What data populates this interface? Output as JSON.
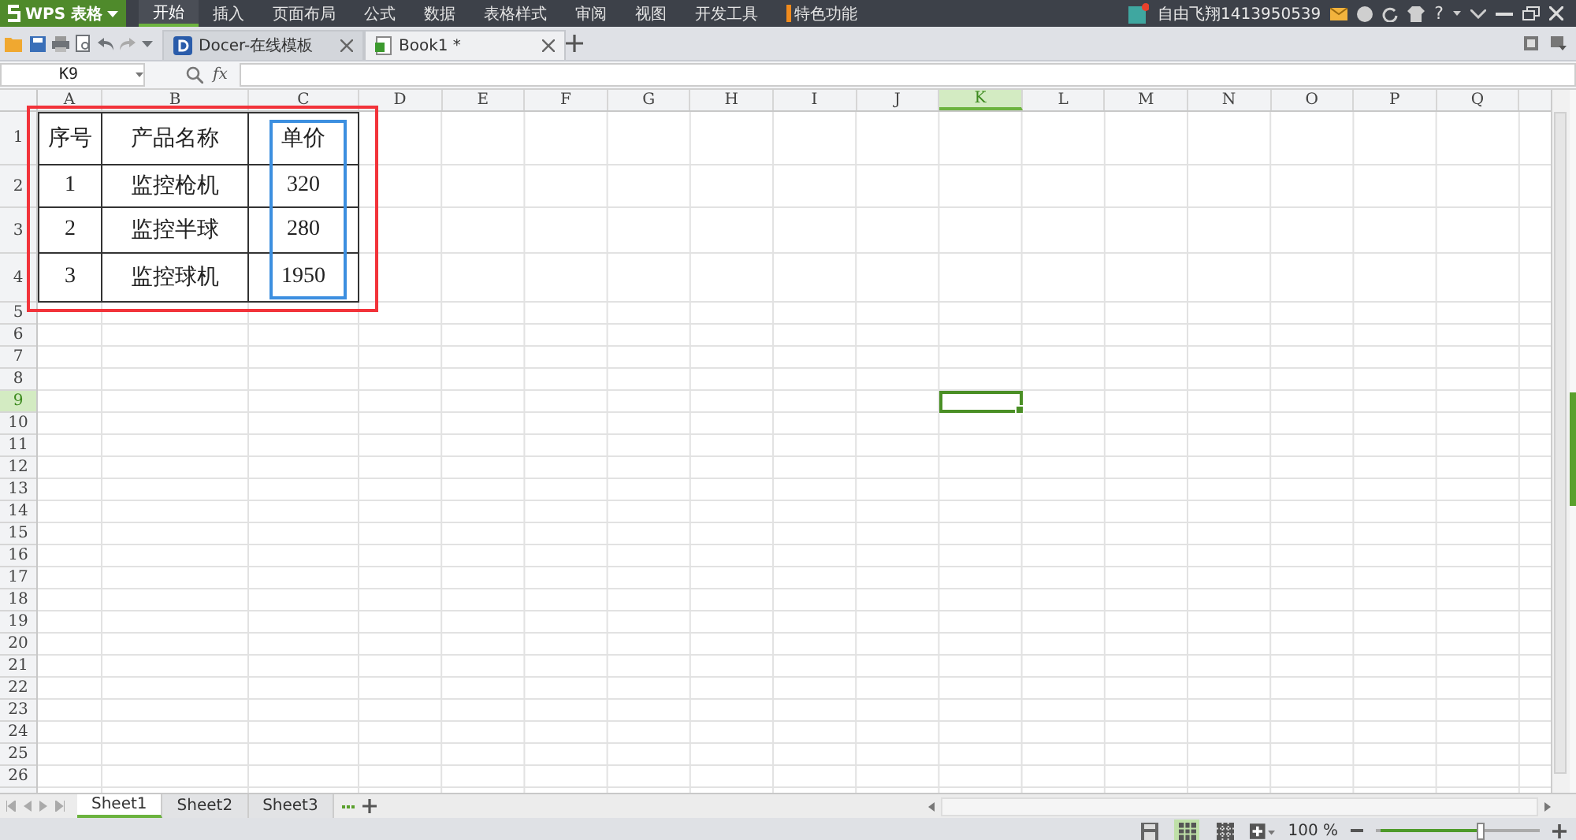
{
  "app_button": {
    "label": "WPS 表格"
  },
  "menu_tabs": [
    {
      "label": "开始",
      "selected": true
    },
    {
      "label": "插入",
      "selected": false
    },
    {
      "label": "页面布局",
      "selected": false
    },
    {
      "label": "公式",
      "selected": false
    },
    {
      "label": "数据",
      "selected": false
    },
    {
      "label": "表格样式",
      "selected": false
    },
    {
      "label": "审阅",
      "selected": false
    },
    {
      "label": "视图",
      "selected": false
    },
    {
      "label": "开发工具",
      "selected": false
    },
    {
      "label": "特色功能",
      "selected": false
    }
  ],
  "user": {
    "name": "自由飞翔1413950539",
    "help_label": "?"
  },
  "doc_tabs": [
    {
      "label": "Docer-在线模板",
      "selected": false,
      "kind": "docer"
    },
    {
      "label": "Book1 *",
      "selected": true,
      "kind": "sheet"
    }
  ],
  "formula_bar": {
    "name_box": "K9",
    "fx_label": "fx"
  },
  "columns": [
    {
      "label": "A",
      "selected": false
    },
    {
      "label": "B",
      "selected": false
    },
    {
      "label": "C",
      "selected": false
    },
    {
      "label": "D",
      "selected": false
    },
    {
      "label": "E",
      "selected": false
    },
    {
      "label": "F",
      "selected": false
    },
    {
      "label": "G",
      "selected": false
    },
    {
      "label": "H",
      "selected": false
    },
    {
      "label": "I",
      "selected": false
    },
    {
      "label": "J",
      "selected": false
    },
    {
      "label": "K",
      "selected": true
    },
    {
      "label": "L",
      "selected": false
    },
    {
      "label": "M",
      "selected": false
    },
    {
      "label": "N",
      "selected": false
    },
    {
      "label": "O",
      "selected": false
    },
    {
      "label": "P",
      "selected": false
    },
    {
      "label": "Q",
      "selected": false
    }
  ],
  "rows": [
    {
      "label": "1",
      "selected": false
    },
    {
      "label": "2",
      "selected": false
    },
    {
      "label": "3",
      "selected": false
    },
    {
      "label": "4",
      "selected": false
    },
    {
      "label": "5",
      "selected": false
    },
    {
      "label": "6",
      "selected": false
    },
    {
      "label": "7",
      "selected": false
    },
    {
      "label": "8",
      "selected": false
    },
    {
      "label": "9",
      "selected": true
    },
    {
      "label": "10",
      "selected": false
    },
    {
      "label": "11",
      "selected": false
    },
    {
      "label": "12",
      "selected": false
    },
    {
      "label": "13",
      "selected": false
    },
    {
      "label": "14",
      "selected": false
    },
    {
      "label": "15",
      "selected": false
    },
    {
      "label": "16",
      "selected": false
    },
    {
      "label": "17",
      "selected": false
    },
    {
      "label": "18",
      "selected": false
    },
    {
      "label": "19",
      "selected": false
    },
    {
      "label": "20",
      "selected": false
    },
    {
      "label": "21",
      "selected": false
    },
    {
      "label": "22",
      "selected": false
    },
    {
      "label": "23",
      "selected": false
    },
    {
      "label": "24",
      "selected": false
    },
    {
      "label": "25",
      "selected": false
    },
    {
      "label": "26",
      "selected": false
    }
  ],
  "table": {
    "rows": [
      [
        "序号",
        "产品名称",
        "单价"
      ],
      [
        "1",
        "监控枪机",
        "320"
      ],
      [
        "2",
        "监控半球",
        "280"
      ],
      [
        "3",
        "监控球机",
        "1950"
      ]
    ]
  },
  "sheet_tabs": [
    {
      "label": "Sheet1",
      "selected": true
    },
    {
      "label": "Sheet2",
      "selected": false
    },
    {
      "label": "Sheet3",
      "selected": false
    }
  ],
  "zoom": {
    "reading": "100 %",
    "level": 0.62
  }
}
